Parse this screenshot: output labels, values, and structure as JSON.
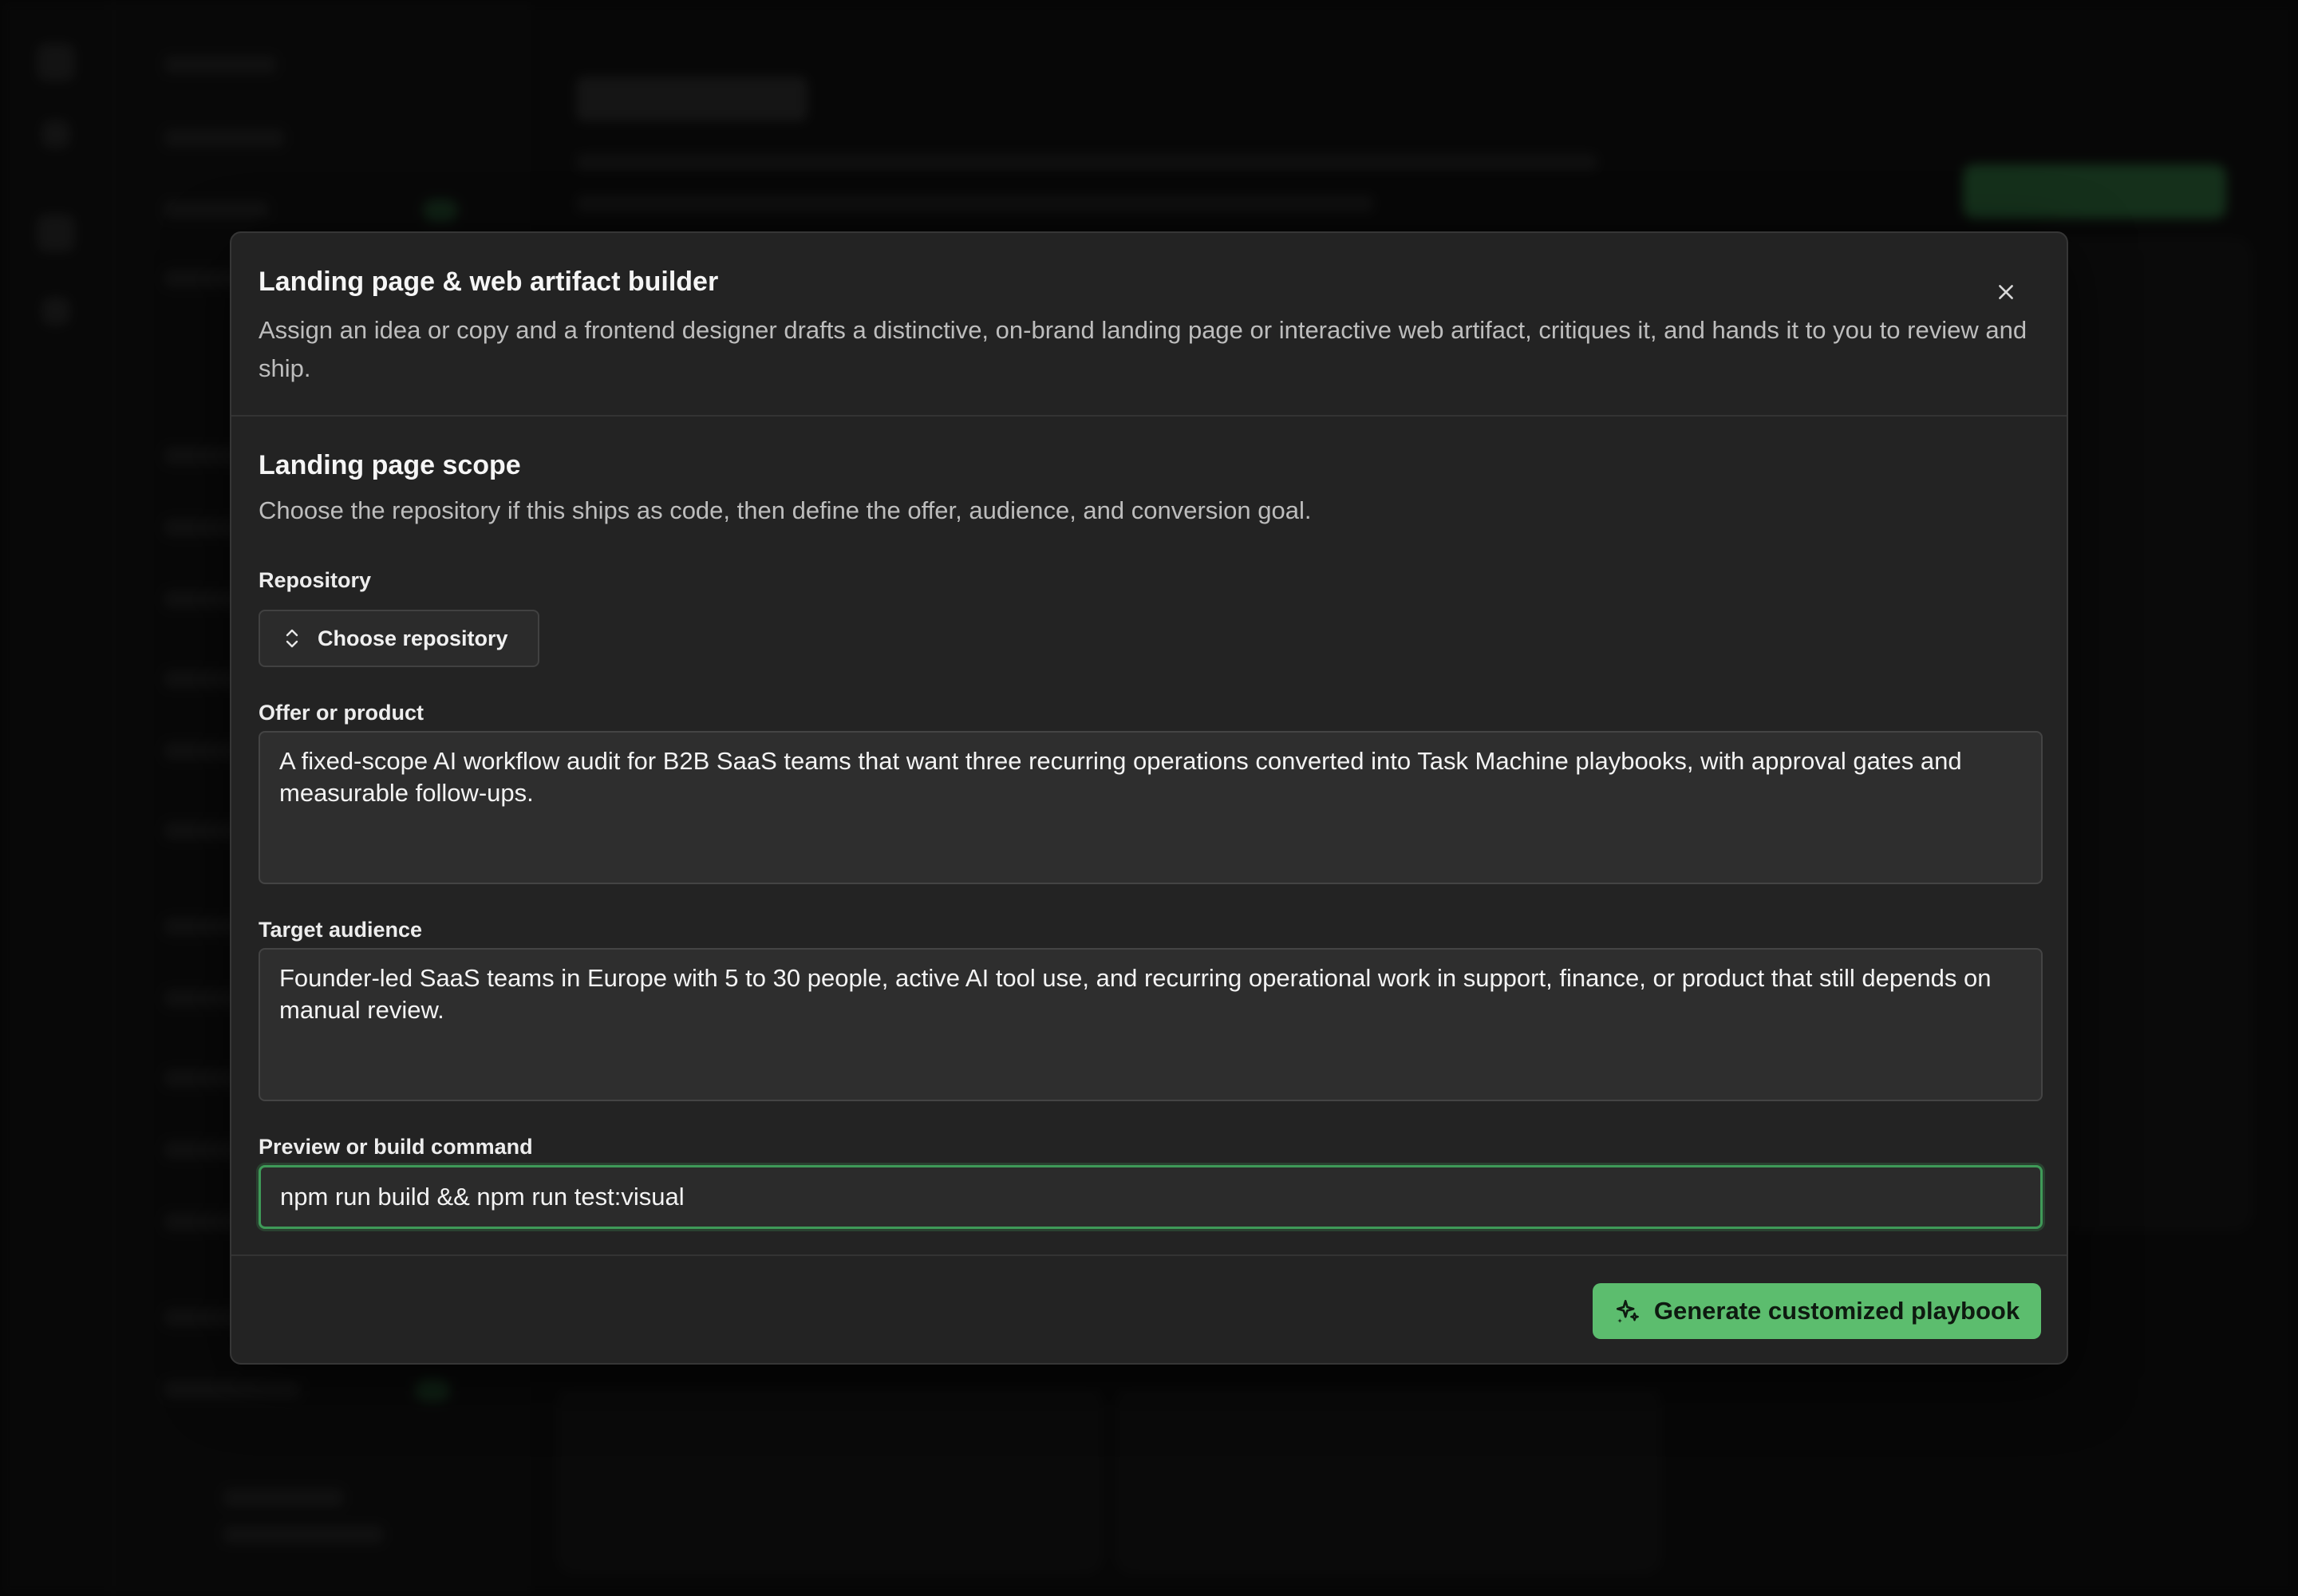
{
  "modal": {
    "title": "Landing page & web artifact builder",
    "description": "Assign an idea or copy and a frontend designer drafts a distinctive, on-brand landing page or interactive web artifact, critiques it, and hands it to you to review and ship.",
    "close_icon": "close-icon"
  },
  "scope": {
    "title": "Landing page scope",
    "description": "Choose the repository if this ships as code, then define the offer, audience, and conversion goal."
  },
  "repository": {
    "label": "Repository",
    "button_label": "Choose repository",
    "icon": "chevron-up-down-icon"
  },
  "offer": {
    "label": "Offer or product",
    "value": "A fixed-scope AI workflow audit for B2B SaaS teams that want three recurring operations converted into Task Machine playbooks, with approval gates and measurable follow-ups."
  },
  "audience": {
    "label": "Target audience",
    "value": "Founder-led SaaS teams in Europe with 5 to 30 people, active AI tool use, and recurring operational work in support, finance, or product that still depends on manual review."
  },
  "command": {
    "label": "Preview or build command",
    "value": "npm run build && npm run test:visual"
  },
  "footer": {
    "generate_label": "Generate customized playbook",
    "icon": "sparkles-icon"
  },
  "colors": {
    "accent": "#5cbd6e",
    "focus_ring": "#3f9a58",
    "modal_bg": "#232323",
    "backdrop": "#0d0d0d"
  }
}
